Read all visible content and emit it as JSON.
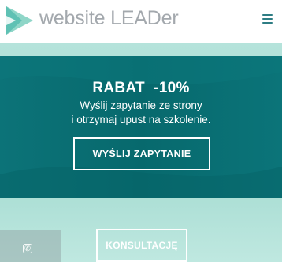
{
  "header": {
    "logo_text": "website LEADer",
    "logo_icon": "play-triangle-logo",
    "menu_icon": "hamburger-menu-icon"
  },
  "banner": {
    "title": "RABAT  -10%",
    "line1": "Wyślij zapytanie ze strony",
    "line2": "i otrzymaj upust na szkolenie.",
    "cta_label": "WYŚLIJ ZAPYTANIE"
  },
  "hero": {
    "button_label": "KONSULTACJĘ",
    "phone_icon": "phone-icon"
  },
  "colors": {
    "banner": "#07696d",
    "hero_bg": "#a9dcd3",
    "logo_text": "#a3a8ad",
    "menu": "#2e7d84"
  }
}
